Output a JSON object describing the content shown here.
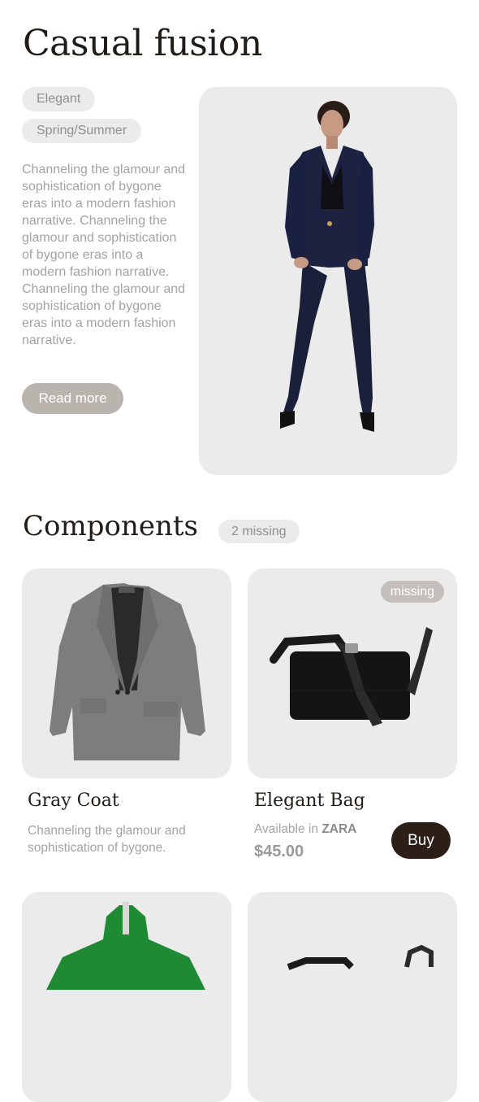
{
  "look": {
    "title": "Casual fusion",
    "tags": [
      "Elegant",
      "Spring/Summer"
    ],
    "description": "Channeling the glamour and sophistication of bygone eras into a modern fashion narrative. Channeling the glamour and sophistication of bygone eras into a modern fashion narrative. Channeling the glamour and sophistication of bygone eras into a modern fashion narrative.",
    "read_more_label": "Read more"
  },
  "components": {
    "title": "Components",
    "missing_count_label": "2 missing",
    "items": [
      {
        "name": "Gray Coat",
        "description": "Channeling the glamour and sophistication of bygone."
      },
      {
        "name": "Elegant Bag",
        "badge": "missing",
        "available_prefix": "Available in",
        "store": "ZARA",
        "price": "$45.00",
        "buy_label": "Buy"
      }
    ]
  },
  "colors": {
    "accent_dark": "#2b1f17",
    "card_bg": "#ebebeb",
    "read_more_bg": "#b9b4ae",
    "suit_navy": "#1c2240",
    "coat_gray": "#7d7d7d",
    "jacket_green": "#1f8a34"
  }
}
